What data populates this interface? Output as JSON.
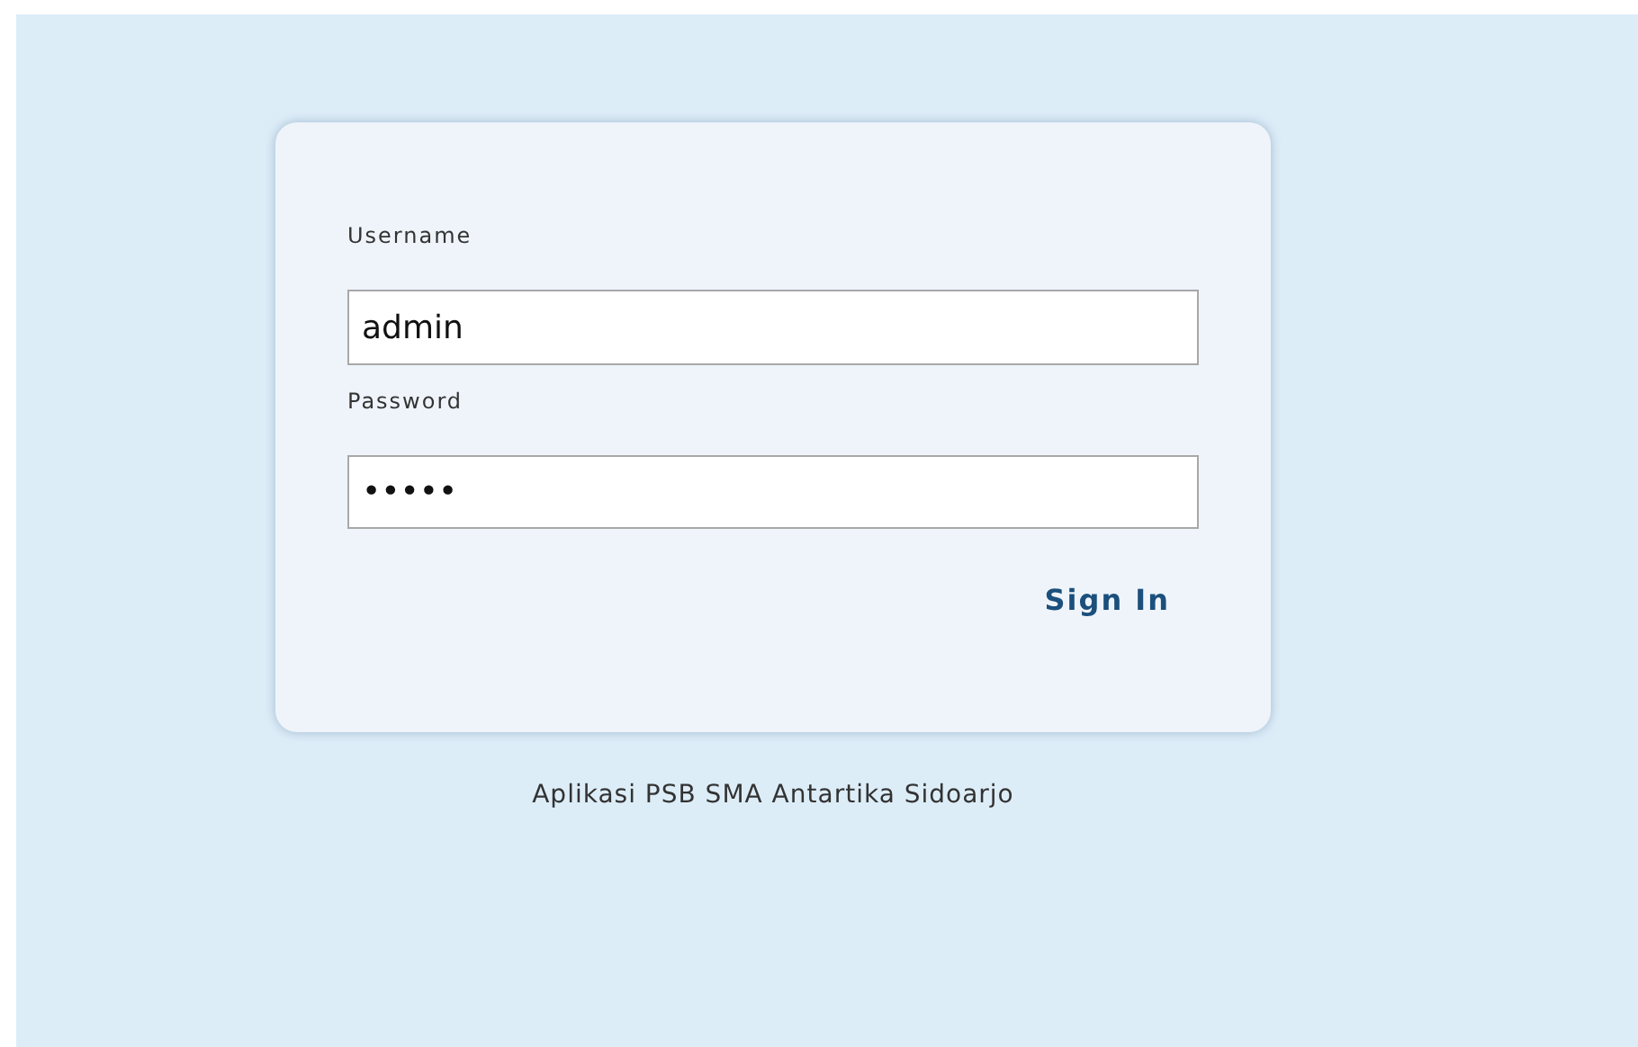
{
  "login_form": {
    "fields": [
      {
        "label": "Username",
        "value": "admin"
      },
      {
        "label": "Password",
        "value": "•••••"
      }
    ],
    "submit": "Sign In"
  },
  "footer": "Aplikasi PSB SMA Antartika Sidoarjo"
}
